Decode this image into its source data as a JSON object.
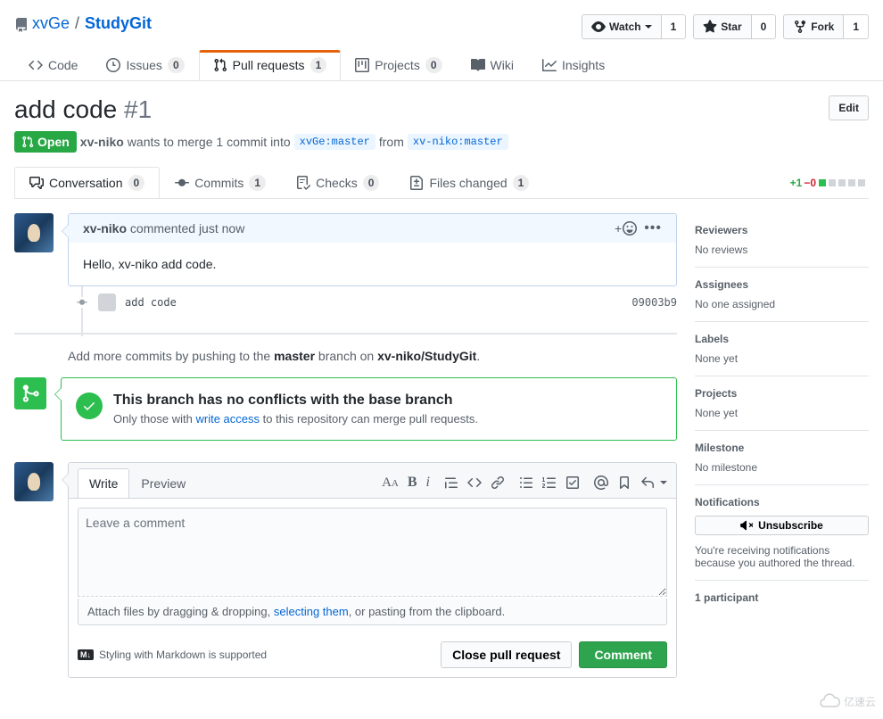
{
  "repo": {
    "owner": "xvGe",
    "name": "StudyGit",
    "sep": "/"
  },
  "pagehead": {
    "watch": "Watch",
    "watch_count": "1",
    "star": "Star",
    "star_count": "0",
    "fork": "Fork",
    "fork_count": "1"
  },
  "tabs": {
    "code": "Code",
    "issues": "Issues",
    "issues_count": "0",
    "pulls": "Pull requests",
    "pulls_count": "1",
    "projects": "Projects",
    "projects_count": "0",
    "wiki": "Wiki",
    "insights": "Insights"
  },
  "pr": {
    "title": "add code",
    "number": "#1",
    "edit": "Edit",
    "state": "Open",
    "meta_author": "xv-niko",
    "meta_text1": "wants to merge 1 commit into",
    "base_ref": "xvGe:master",
    "meta_text2": "from",
    "head_ref": "xv-niko:master"
  },
  "pr_tabs": {
    "conversation": "Conversation",
    "conversation_count": "0",
    "commits": "Commits",
    "commits_count": "1",
    "checks": "Checks",
    "checks_count": "0",
    "files": "Files changed",
    "files_count": "1"
  },
  "diffstat": {
    "add": "+1",
    "del": "−0"
  },
  "comment": {
    "author": "xv-niko",
    "action": "commented just now",
    "body": "Hello, xv-niko add code.",
    "plus": "+"
  },
  "commit": {
    "msg": "add code",
    "sha": "09003b9"
  },
  "push_hint": {
    "t1": "Add more commits by pushing to the ",
    "branch": "master",
    "t2": " branch on ",
    "repo": "xv-niko/StudyGit",
    "t3": "."
  },
  "merge": {
    "title": "This branch has no conflicts with the base branch",
    "text1": "Only those with ",
    "link": "write access",
    "text2": " to this repository can merge pull requests."
  },
  "form": {
    "write_tab": "Write",
    "preview_tab": "Preview",
    "placeholder": "Leave a comment",
    "attach1": "Attach files by dragging & dropping, ",
    "attach_link": "selecting them",
    "attach2": ", or pasting from the clipboard.",
    "md_badge": "M↓",
    "md_hint": "Styling with Markdown is supported",
    "close": "Close pull request",
    "comment": "Comment"
  },
  "side": {
    "reviewers": "Reviewers",
    "reviewers_val": "No reviews",
    "assignees": "Assignees",
    "assignees_val": "No one assigned",
    "labels": "Labels",
    "labels_val": "None yet",
    "projects": "Projects",
    "projects_val": "None yet",
    "milestone": "Milestone",
    "milestone_val": "No milestone",
    "notifications": "Notifications",
    "unsubscribe": "Unsubscribe",
    "notif_desc": "You're receiving notifications because you authored the thread.",
    "participants": "1 participant"
  },
  "watermark": "亿速云"
}
